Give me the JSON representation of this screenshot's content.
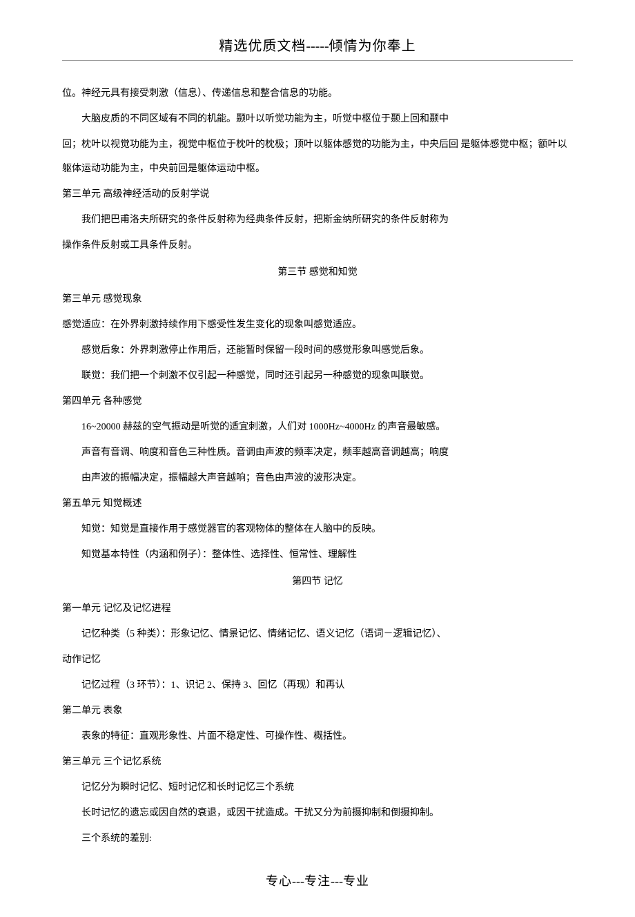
{
  "header": {
    "prefix": "精选优质文档",
    "dash": "-----",
    "suffix": "倾情为你奉上"
  },
  "content": {
    "p1": "位。神经元具有接受刺激（信息）、传递信息和整合信息的功能。",
    "p2": "大脑皮质的不同区域有不同的机能。颞叶以听觉功能为主，听觉中枢位于颞上回和颞中",
    "p3": "回；枕叶以视觉功能为主，视觉中枢位于枕叶的枕极；顶叶以躯体感觉的功能为主，中央后回 是躯体感觉中枢；额叶以躯体运动功能为主，中央前回是躯体运动中枢。",
    "u3_1": "第三单元  高级神经活动的反射学说",
    "p4": "我们把巴甫洛夫所研究的条件反射称为经典条件反射，把斯金纳所研究的条件反射称为",
    "p5": "操作条件反射或工具条件反射。",
    "s3_title": "第三节  感觉和知觉",
    "u3_2": "第三单元  感觉现象",
    "p6": "感觉适应：在外界刺激持续作用下感受性发生变化的现象叫感觉适应。",
    "p7": "感觉后象：外界刺激停止作用后，还能暂时保留一段时间的感觉形象叫感觉后象。",
    "p8": "联觉：我们把一个刺激不仅引起一种感觉，同时还引起另一种感觉的现象叫联觉。",
    "u4": "第四单元  各种感觉",
    "p9": "16~20000 赫兹的空气振动是听觉的适宜刺激，人们对 1000Hz~4000Hz 的声音最敏感。",
    "p10": "声音有音调、响度和音色三种性质。音调由声波的频率决定，频率越高音调越高；响度",
    "p11": "由声波的振幅决定，振幅越大声音越响；音色由声波的波形决定。",
    "u5": "第五单元  知觉概述",
    "p12": "知觉：知觉是直接作用于感觉器官的客观物体的整体在人脑中的反映。",
    "p13": "知觉基本特性（内涵和例子）：整体性、选择性、恒常性、理解性",
    "s4_title": "第四节  记忆",
    "u1_4": "第一单元  记忆及记忆进程",
    "p14": "记忆种类（5 种类）：形象记忆、情景记忆、情绪记忆、语义记忆（语词－逻辑记忆）、",
    "p15": "动作记忆",
    "p16": "记忆过程（3 环节）：1、识记   2、保持   3、回忆（再现）和再认",
    "u2_4": "第二单元  表象",
    "p17": "表象的特征：直观形象性、片面不稳定性、可操作性、概括性。",
    "u3_4": "第三单元  三个记忆系统",
    "p18": "记忆分为瞬时记忆、短时记忆和长时记忆三个系统",
    "p19": "长时记忆的遗忘或因自然的衰退，或因干扰造成。干扰又分为前摄抑制和倒摄抑制。",
    "p20": "三个系统的差别:"
  },
  "footer": {
    "part1": "专心",
    "dash1": "---",
    "part2": "专注",
    "dash2": "---",
    "part3": "专业"
  }
}
